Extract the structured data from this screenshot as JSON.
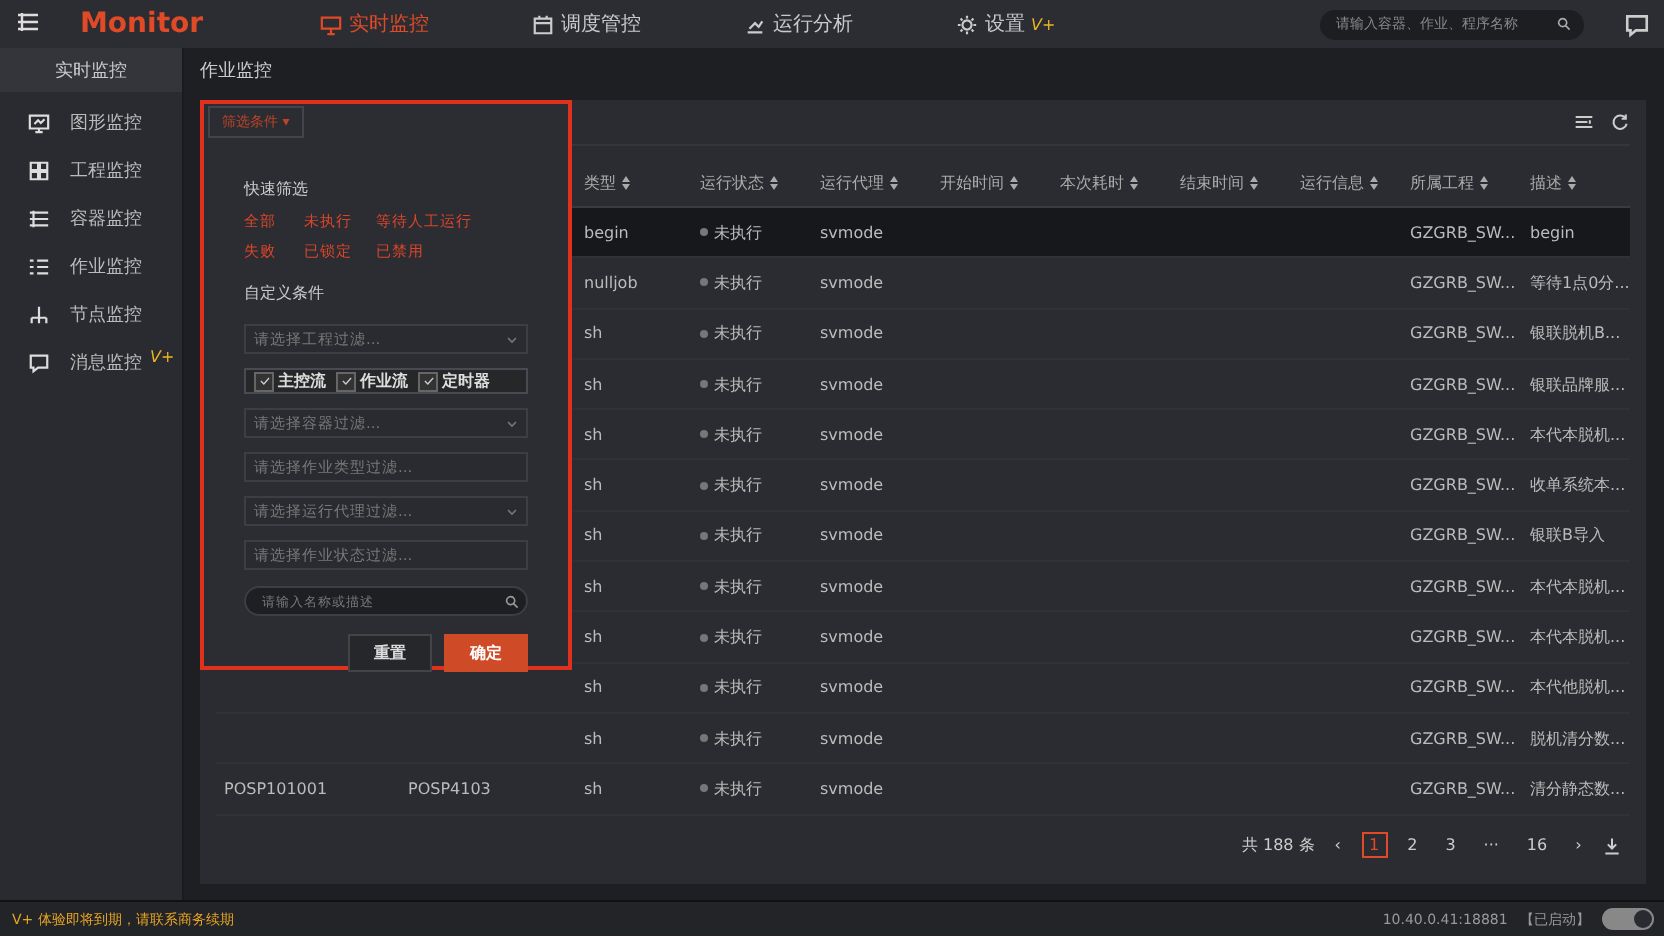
{
  "topbar": {
    "brand": "Monitor",
    "nav": [
      {
        "label": "实时监控",
        "selected": true
      },
      {
        "label": "调度管控",
        "selected": false
      },
      {
        "label": "运行分析",
        "selected": false
      },
      {
        "label": "设置",
        "selected": false,
        "badge": "V+"
      }
    ],
    "search": {
      "placeholder": "请输入容器、作业、程序名称"
    }
  },
  "sidebar": {
    "title": "实时监控",
    "items": [
      {
        "label": "图形监控"
      },
      {
        "label": "工程监控"
      },
      {
        "label": "容器监控"
      },
      {
        "label": "作业监控"
      },
      {
        "label": "节点监控"
      },
      {
        "label": "消息监控",
        "badge": "V+"
      }
    ]
  },
  "breadcrumb": "作业监控",
  "filter": {
    "button": "筛选条件 ▾",
    "quick_title": "快速筛选",
    "quick": [
      [
        "全部",
        "未执行",
        "等待人工运行"
      ],
      [
        "失败",
        "已锁定",
        "已禁用"
      ]
    ],
    "custom_title": "自定义条件",
    "fields": [
      {
        "kind": "select",
        "placeholder": "请选择工程过滤..."
      },
      {
        "kind": "checks",
        "options": [
          {
            "label": "主控流",
            "checked": true
          },
          {
            "label": "作业流",
            "checked": true
          },
          {
            "label": "定时器",
            "checked": true
          }
        ]
      },
      {
        "kind": "select",
        "placeholder": "请选择容器过滤..."
      },
      {
        "kind": "input",
        "placeholder": "请选择作业类型过滤..."
      },
      {
        "kind": "select",
        "placeholder": "请选择运行代理过滤..."
      },
      {
        "kind": "input",
        "placeholder": "请选择作业状态过滤..."
      },
      {
        "kind": "search",
        "placeholder": "请输入名称或描述"
      }
    ],
    "reset": "重置",
    "confirm": "确定"
  },
  "table": {
    "columns": [
      "类型",
      "运行状态",
      "运行代理",
      "开始时间",
      "本次耗时",
      "结束时间",
      "运行信息",
      "所属工程",
      "描述"
    ],
    "rows": [
      {
        "selected": true,
        "cells": [
          "begin",
          "未执行",
          "svmode",
          "",
          "",
          "",
          "",
          "GZGRB_SW...",
          "begin"
        ]
      },
      {
        "selected": false,
        "cells": [
          "nulljob",
          "未执行",
          "svmode",
          "",
          "",
          "",
          "",
          "GZGRB_SW...",
          "等待1点0分..."
        ]
      },
      {
        "selected": false,
        "cells": [
          "sh",
          "未执行",
          "svmode",
          "",
          "",
          "",
          "",
          "GZGRB_SW...",
          "银联脱机B..."
        ]
      },
      {
        "selected": false,
        "cells": [
          "sh",
          "未执行",
          "svmode",
          "",
          "",
          "",
          "",
          "GZGRB_SW...",
          "银联品牌服..."
        ]
      },
      {
        "selected": false,
        "cells": [
          "sh",
          "未执行",
          "svmode",
          "",
          "",
          "",
          "",
          "GZGRB_SW...",
          "本代本脱机..."
        ]
      },
      {
        "selected": false,
        "cells": [
          "sh",
          "未执行",
          "svmode",
          "",
          "",
          "",
          "",
          "GZGRB_SW...",
          "收单系统本..."
        ]
      },
      {
        "selected": false,
        "cells": [
          "sh",
          "未执行",
          "svmode",
          "",
          "",
          "",
          "",
          "GZGRB_SW...",
          "银联B导入"
        ]
      },
      {
        "selected": false,
        "cells": [
          "sh",
          "未执行",
          "svmode",
          "",
          "",
          "",
          "",
          "GZGRB_SW...",
          "本代本脱机..."
        ]
      },
      {
        "selected": false,
        "cells": [
          "sh",
          "未执行",
          "svmode",
          "",
          "",
          "",
          "",
          "GZGRB_SW...",
          "本代本脱机..."
        ]
      },
      {
        "selected": false,
        "cells": [
          "sh",
          "未执行",
          "svmode",
          "",
          "",
          "",
          "",
          "GZGRB_SW...",
          "本代他脱机..."
        ]
      },
      {
        "selected": false,
        "cells": [
          "sh",
          "未执行",
          "svmode",
          "",
          "",
          "",
          "",
          "GZGRB_SW...",
          "脱机清分数..."
        ]
      },
      {
        "selected": false,
        "column_1": "POSP101001",
        "column_2": "POSP4103",
        "cells": [
          "sh",
          "未执行",
          "svmode",
          "",
          "",
          "",
          "",
          "GZGRB_SW...",
          "清分静态数..."
        ]
      }
    ]
  },
  "pagination": {
    "total": "共 188 条",
    "prev": "‹",
    "pages": [
      {
        "label": "1",
        "selected": true
      },
      {
        "label": "2",
        "selected": false
      },
      {
        "label": "3",
        "selected": false
      },
      {
        "label": "···",
        "selected": false
      },
      {
        "label": "16",
        "selected": false
      }
    ],
    "next": "›"
  },
  "status_bar": {
    "notice": "V+ 体验即将到期，请联系商务续期",
    "server": "10.40.0.41:18881",
    "state": "【已启动】",
    "toggle": {
      "on": true
    }
  }
}
